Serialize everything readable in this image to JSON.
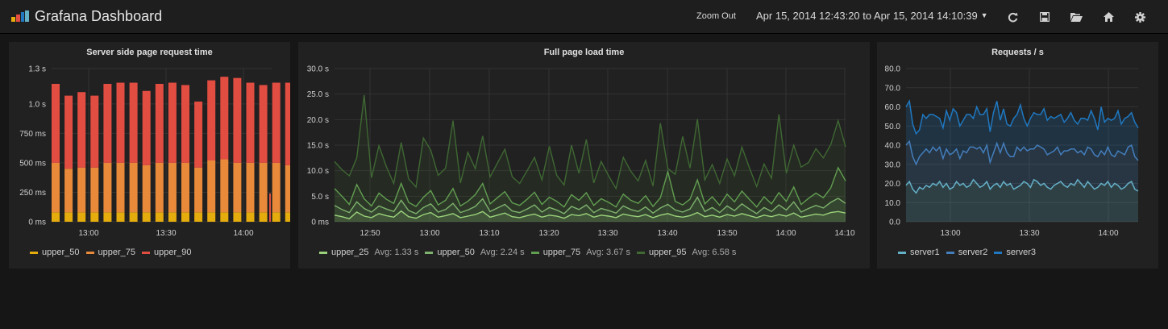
{
  "navbar": {
    "title": "Grafana Dashboard",
    "zoom_out": "Zoom Out",
    "time_range": "Apr 15, 2014 12:43:20 to Apr 15, 2014 14:10:39",
    "icons": [
      "refresh-icon",
      "save-icon",
      "folder-open-icon",
      "home-icon",
      "gear-icon"
    ]
  },
  "colors": {
    "upper_50_bar": "#e5ac0e",
    "upper_75_bar": "#e98a3a",
    "upper_90_bar": "#e24d42",
    "upper_25_line": "#9ad17b",
    "upper_50_line": "#7eb26d",
    "upper_75_line": "#629e51",
    "upper_95_line": "#3f6833",
    "server1": "#64b0c8",
    "server2": "#447ebc",
    "server3": "#1f78c1"
  },
  "chart_data": [
    {
      "type": "bar",
      "title": "Server side page request time",
      "ylim": [
        0,
        1.3
      ],
      "yticks": [
        "1.3 s",
        "1.0 s",
        "750 ms",
        "500 ms",
        "250 ms",
        "0 ms"
      ],
      "ytick_values": [
        1.3,
        1.0,
        0.75,
        0.5,
        0.25,
        0
      ],
      "xticks": [
        "13:00",
        "13:30",
        "14:00"
      ],
      "stacked": true,
      "series": [
        {
          "name": "upper_50",
          "values": [
            0.08,
            0.08,
            0.08,
            0.08,
            0.08,
            0.08,
            0.08,
            0.08,
            0.08,
            0.08,
            0.08,
            0.08,
            0.08,
            0.08,
            0.08,
            0.08,
            0.08,
            0.08,
            0.08,
            0.08
          ]
        },
        {
          "name": "upper_75",
          "values": [
            0.42,
            0.37,
            0.38,
            0.38,
            0.42,
            0.42,
            0.42,
            0.4,
            0.42,
            0.42,
            0.42,
            0.38,
            0.44,
            0.45,
            0.42,
            0.42,
            0.42,
            0.42,
            0.4,
            0.4
          ]
        },
        {
          "name": "upper_90",
          "values": [
            0.67,
            0.62,
            0.64,
            0.61,
            0.67,
            0.68,
            0.68,
            0.63,
            0.67,
            0.68,
            0.66,
            0.56,
            0.68,
            0.7,
            0.72,
            0.68,
            0.66,
            0.68,
            0.7,
            0.7
          ]
        }
      ],
      "legend": [
        "upper_50",
        "upper_75",
        "upper_90"
      ]
    },
    {
      "type": "area",
      "title": "Full page load time",
      "ylim": [
        0,
        30
      ],
      "yticks": [
        "30.0 s",
        "25.0 s",
        "20.0 s",
        "15.0 s",
        "10.0 s",
        "5.0 s",
        "0 ms"
      ],
      "ytick_values": [
        30,
        25,
        20,
        15,
        10,
        5,
        0
      ],
      "xticks": [
        "12:50",
        "13:00",
        "13:10",
        "13:20",
        "13:30",
        "13:40",
        "13:50",
        "14:00",
        "14:10"
      ],
      "series": [
        {
          "name": "upper_25",
          "avg": "Avg: 1.33 s",
          "values": [
            1.3,
            1.0,
            0.6,
            1.9,
            1.1,
            0.8,
            1.6,
            1.2,
            0.9,
            2.1,
            1.0,
            0.7,
            1.4,
            1.8,
            0.9,
            1.2,
            1.6,
            0.8,
            1.1,
            1.4,
            2.0,
            0.9,
            1.3,
            1.7,
            1.0,
            0.8,
            1.2,
            1.5,
            0.9,
            1.3,
            1.1,
            0.7,
            1.4,
            1.2,
            1.6,
            0.9,
            1.3,
            1.1,
            0.8,
            1.5,
            1.2,
            1.0,
            1.4,
            0.8,
            1.3,
            1.6,
            1.1,
            0.9,
            1.2,
            1.8,
            1.0,
            1.3,
            0.9,
            1.4,
            1.1,
            1.6,
            1.2,
            0.8,
            1.3,
            1.0,
            1.4,
            1.1,
            1.7,
            0.9,
            1.2,
            1.5,
            1.3,
            1.8,
            2.0,
            1.7
          ]
        },
        {
          "name": "upper_50",
          "avg": "Avg: 2.24 s",
          "values": [
            3.2,
            2.4,
            1.8,
            3.9,
            2.6,
            1.9,
            3.1,
            2.5,
            2.0,
            4.2,
            2.2,
            1.6,
            2.8,
            3.5,
            1.9,
            2.4,
            3.6,
            1.8,
            2.3,
            3.0,
            4.5,
            2.0,
            2.7,
            3.4,
            2.1,
            1.8,
            2.5,
            3.3,
            1.9,
            2.8,
            2.3,
            1.6,
            3.0,
            2.4,
            3.3,
            1.8,
            2.6,
            2.2,
            1.7,
            3.1,
            2.4,
            2.0,
            2.9,
            1.7,
            2.7,
            3.4,
            2.3,
            1.9,
            2.5,
            4.8,
            2.0,
            2.8,
            1.8,
            3.1,
            2.2,
            3.5,
            2.5,
            1.6,
            2.8,
            2.0,
            3.3,
            2.3,
            3.9,
            1.9,
            2.6,
            3.2,
            2.7,
            3.8,
            4.6,
            3.6
          ]
        },
        {
          "name": "upper_75",
          "avg": "Avg: 3.67 s",
          "values": [
            6.5,
            5.0,
            3.4,
            7.3,
            4.5,
            3.1,
            5.6,
            4.4,
            3.6,
            7.5,
            3.8,
            3.0,
            4.8,
            6.1,
            3.3,
            4.2,
            6.5,
            3.1,
            4.0,
            5.3,
            7.5,
            3.5,
            4.7,
            5.9,
            3.7,
            3.2,
            4.4,
            5.8,
            3.4,
            4.8,
            4.0,
            2.9,
            5.3,
            4.2,
            5.7,
            3.2,
            4.5,
            3.8,
            2.9,
            5.4,
            4.2,
            3.6,
            5.1,
            3.0,
            4.7,
            9.8,
            4.0,
            3.3,
            4.4,
            8.2,
            3.5,
            4.9,
            3.2,
            5.4,
            3.9,
            6.0,
            4.4,
            2.9,
            4.9,
            3.5,
            5.7,
            4.0,
            6.8,
            3.4,
            4.6,
            5.6,
            4.7,
            6.6,
            10.6,
            8.0
          ]
        },
        {
          "name": "upper_95",
          "avg": "Avg: 6.58 s",
          "values": [
            11.8,
            10.2,
            9.0,
            12.5,
            24.8,
            8.6,
            14.9,
            10.8,
            7.5,
            15.5,
            8.4,
            6.8,
            16.4,
            14.0,
            9.1,
            10.5,
            19.8,
            7.6,
            13.6,
            10.4,
            16.8,
            8.8,
            11.5,
            14.2,
            8.8,
            7.5,
            10.0,
            12.6,
            8.2,
            14.8,
            9.1,
            7.2,
            15.0,
            9.5,
            16.1,
            7.6,
            11.8,
            9.0,
            6.5,
            12.6,
            9.9,
            8.0,
            12.0,
            7.0,
            19.3,
            10.4,
            9.3,
            16.7,
            10.5,
            20.1,
            8.2,
            11.2,
            7.5,
            12.3,
            9.0,
            14.6,
            10.6,
            6.9,
            11.3,
            8.5,
            21.0,
            9.5,
            15.0,
            10.7,
            11.6,
            14.3,
            12.5,
            15.1,
            19.8,
            14.7
          ]
        }
      ],
      "legend": [
        "upper_25",
        "upper_50",
        "upper_75",
        "upper_95"
      ]
    },
    {
      "type": "area",
      "title": "Requests / s",
      "ylim": [
        0,
        80
      ],
      "yticks": [
        "80.0",
        "70.0",
        "60.0",
        "50.0",
        "40.0",
        "30.0",
        "20.0",
        "10.0",
        "0.0"
      ],
      "ytick_values": [
        80,
        70,
        60,
        50,
        40,
        30,
        20,
        10,
        0
      ],
      "xticks": [
        "13:00",
        "13:30",
        "14:00"
      ],
      "stacked": true,
      "series": [
        {
          "name": "server1",
          "values": [
            19,
            21,
            17,
            15,
            18,
            17,
            19,
            18,
            20,
            19,
            21,
            18,
            20,
            17,
            18,
            21,
            19,
            20,
            18,
            19,
            22,
            20,
            18,
            19,
            21,
            17,
            19,
            20,
            18,
            21,
            19,
            20,
            17,
            18,
            19,
            21,
            20,
            18,
            22,
            21,
            19,
            20,
            18,
            17,
            19,
            20,
            21,
            19,
            18,
            20,
            19,
            22,
            20,
            18,
            21,
            19,
            17,
            18,
            20,
            19,
            21,
            18,
            20,
            19,
            17,
            18,
            20,
            21,
            17,
            16
          ]
        },
        {
          "name": "server2",
          "values": [
            21,
            21,
            17,
            15,
            16,
            19,
            19,
            18,
            19,
            18,
            18,
            15,
            18,
            18,
            18,
            17,
            14,
            17,
            18,
            20,
            17,
            18,
            21,
            17,
            19,
            14,
            17,
            21,
            18,
            20,
            17,
            14,
            17,
            21,
            18,
            18,
            17,
            20,
            16,
            19,
            20,
            18,
            17,
            19,
            18,
            19,
            14,
            18,
            19,
            18,
            19,
            14,
            17,
            17,
            18,
            19,
            18,
            16,
            17,
            16,
            18,
            17,
            14,
            18,
            19,
            17,
            19,
            19,
            17,
            16
          ]
        },
        {
          "name": "server3",
          "values": [
            20,
            21,
            17,
            16,
            14,
            20,
            16,
            20,
            17,
            18,
            15,
            16,
            20,
            18,
            23,
            19,
            17,
            16,
            20,
            17,
            15,
            22,
            17,
            20,
            19,
            16,
            21,
            22,
            17,
            18,
            15,
            16,
            20,
            17,
            24,
            15,
            13,
            16,
            19,
            16,
            17,
            21,
            18,
            19,
            17,
            16,
            21,
            15,
            17,
            19,
            15,
            15,
            17,
            19,
            14,
            20,
            19,
            14,
            23,
            17,
            15,
            18,
            20,
            21,
            15,
            19,
            16,
            17,
            18,
            17
          ]
        }
      ],
      "legend": [
        "server1",
        "server2",
        "server3"
      ]
    }
  ]
}
